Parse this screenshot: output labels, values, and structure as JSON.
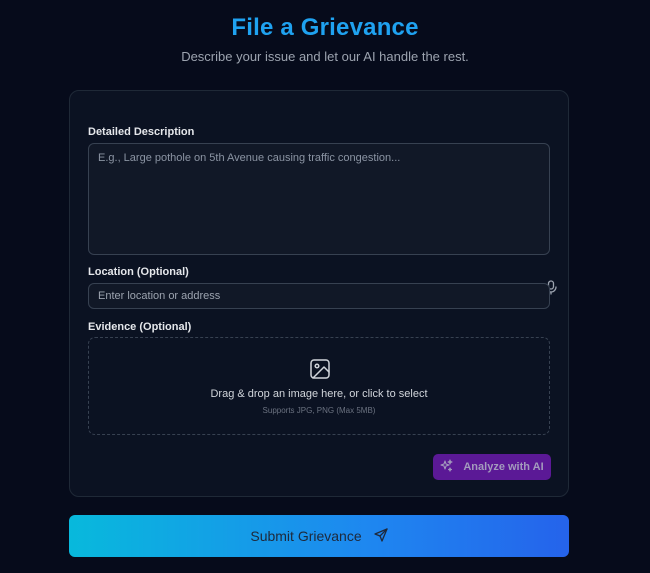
{
  "header": {
    "title": "File a Grievance",
    "subtitle": "Describe your issue and let our AI handle the rest."
  },
  "form": {
    "description": {
      "label": "Detailed Description",
      "placeholder": "E.g., Large pothole on 5th Avenue causing traffic congestion...",
      "mic_icon": "microphone-icon"
    },
    "location": {
      "label": "Location (Optional)",
      "placeholder": "Enter location or address"
    },
    "evidence": {
      "label": "Evidence (Optional)",
      "dropzone_text": "Drag & drop an image here, or click to select",
      "dropzone_subtext": "Supports JPG, PNG (Max 5MB)",
      "icon": "image-icon"
    },
    "analyze_button": {
      "label": "Analyze with AI",
      "icon": "sparkles-icon"
    }
  },
  "submit_button": {
    "label": "Submit Grievance",
    "icon": "send-icon"
  },
  "colors": {
    "background": "#060b1b",
    "title": "#1fa2f0",
    "card": "#0b1222",
    "analyze_bg": "#5b1996",
    "submit_gradient_start": "#08b9dc",
    "submit_gradient_end": "#2563eb"
  }
}
